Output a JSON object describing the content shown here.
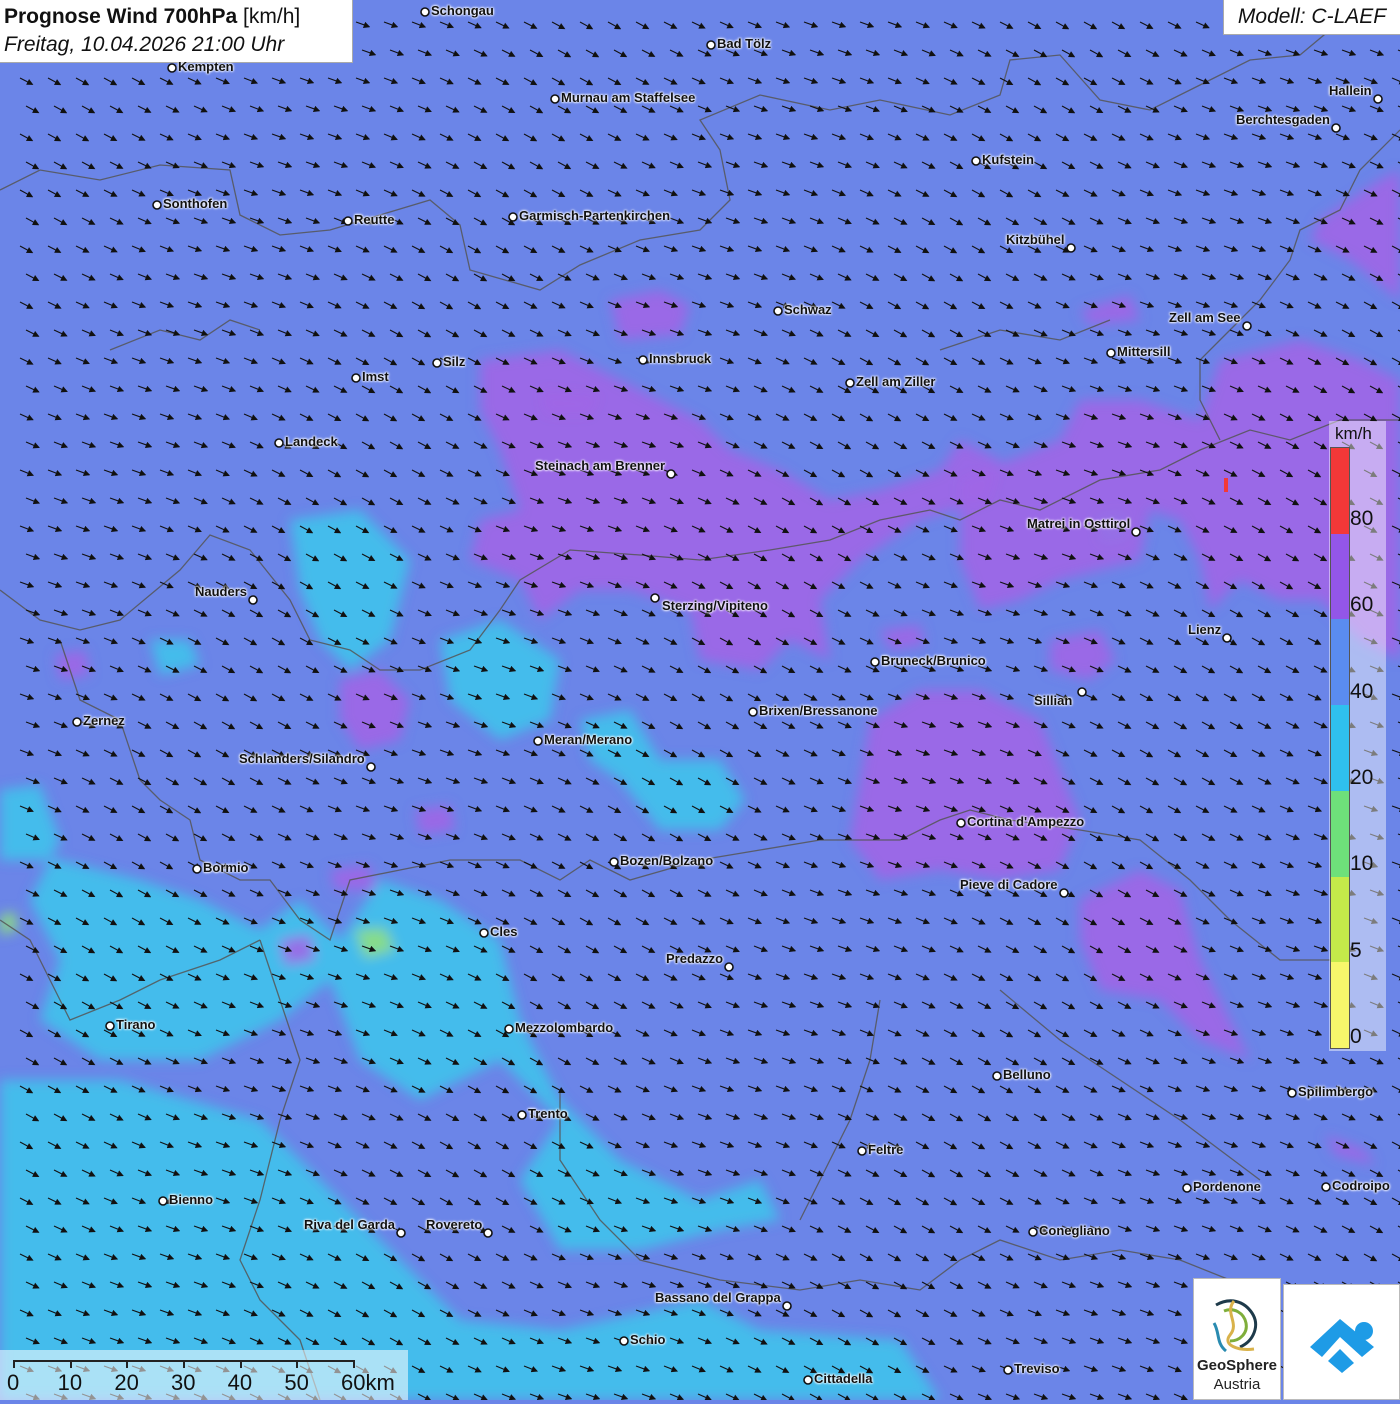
{
  "title": {
    "main": "Prognose Wind 700hPa",
    "unit": "[km/h]",
    "datetime": "Freitag, 10.04.2026 21:00 Uhr"
  },
  "model": "Modell: C-LAEF",
  "legend": {
    "unit": "km/h",
    "ticks": [
      "80",
      "60",
      "40",
      "20",
      "10",
      "5",
      "0"
    ],
    "colors": [
      "#f33838",
      "#9356e8",
      "#5a8cf0",
      "#2fc0ee",
      "#6ee07a",
      "#c4ea4a",
      "#f7f76b"
    ]
  },
  "colors": {
    "background": "#6b85e8",
    "purple_zone": "#a065e6",
    "cyan_zone": "#40c4ec",
    "green_zone": "#8fe07c",
    "border": "#555555"
  },
  "cities": [
    {
      "name": "Schongau"
    },
    {
      "name": "Bad Tölz"
    },
    {
      "name": "Kempten"
    },
    {
      "name": "Murnau am Staffelsee"
    },
    {
      "name": "Hallein"
    },
    {
      "name": "Berchtesgaden"
    },
    {
      "name": "Kufstein"
    },
    {
      "name": "Sonthofen"
    },
    {
      "name": "Reutte"
    },
    {
      "name": "Garmisch-Partenkirchen"
    },
    {
      "name": "Kitzbühel"
    },
    {
      "name": "Schwaz"
    },
    {
      "name": "Zell am See"
    },
    {
      "name": "Mittersill"
    },
    {
      "name": "Innsbruck"
    },
    {
      "name": "Silz"
    },
    {
      "name": "Imst"
    },
    {
      "name": "Zell am Ziller"
    },
    {
      "name": "Landeck"
    },
    {
      "name": "Steinach am Brenner"
    },
    {
      "name": "Matrei in Osttirol"
    },
    {
      "name": "Nauders"
    },
    {
      "name": "Sterzing/Vipiteno"
    },
    {
      "name": "Lienz"
    },
    {
      "name": "Bruneck/Brunico"
    },
    {
      "name": "Sillian"
    },
    {
      "name": "Zernez"
    },
    {
      "name": "Brixen/Bressanone"
    },
    {
      "name": "Meran/Merano"
    },
    {
      "name": "Schlanders/Silandro"
    },
    {
      "name": "Cortina d'Ampezzo"
    },
    {
      "name": "Bozen/Bolzano"
    },
    {
      "name": "Bormio"
    },
    {
      "name": "Pieve di Cadore"
    },
    {
      "name": "Cles"
    },
    {
      "name": "Predazzo"
    },
    {
      "name": "Tirano"
    },
    {
      "name": "Mezzolombardo"
    },
    {
      "name": "Belluno"
    },
    {
      "name": "Spilimbergo"
    },
    {
      "name": "Trento"
    },
    {
      "name": "Feltre"
    },
    {
      "name": "Pordenone"
    },
    {
      "name": "Codroipo"
    },
    {
      "name": "Bienno"
    },
    {
      "name": "Riva del Garda"
    },
    {
      "name": "Rovereto"
    },
    {
      "name": "Conegliano"
    },
    {
      "name": "Bassano del Grappa"
    },
    {
      "name": "Schio"
    },
    {
      "name": "Treviso"
    },
    {
      "name": "Cittadella"
    }
  ],
  "scale": {
    "labels": [
      "0",
      "10",
      "20",
      "30",
      "40",
      "50",
      "60km"
    ]
  },
  "logos": {
    "geosphere_line1": "GeoSphere",
    "geosphere_line2": "Austria"
  }
}
